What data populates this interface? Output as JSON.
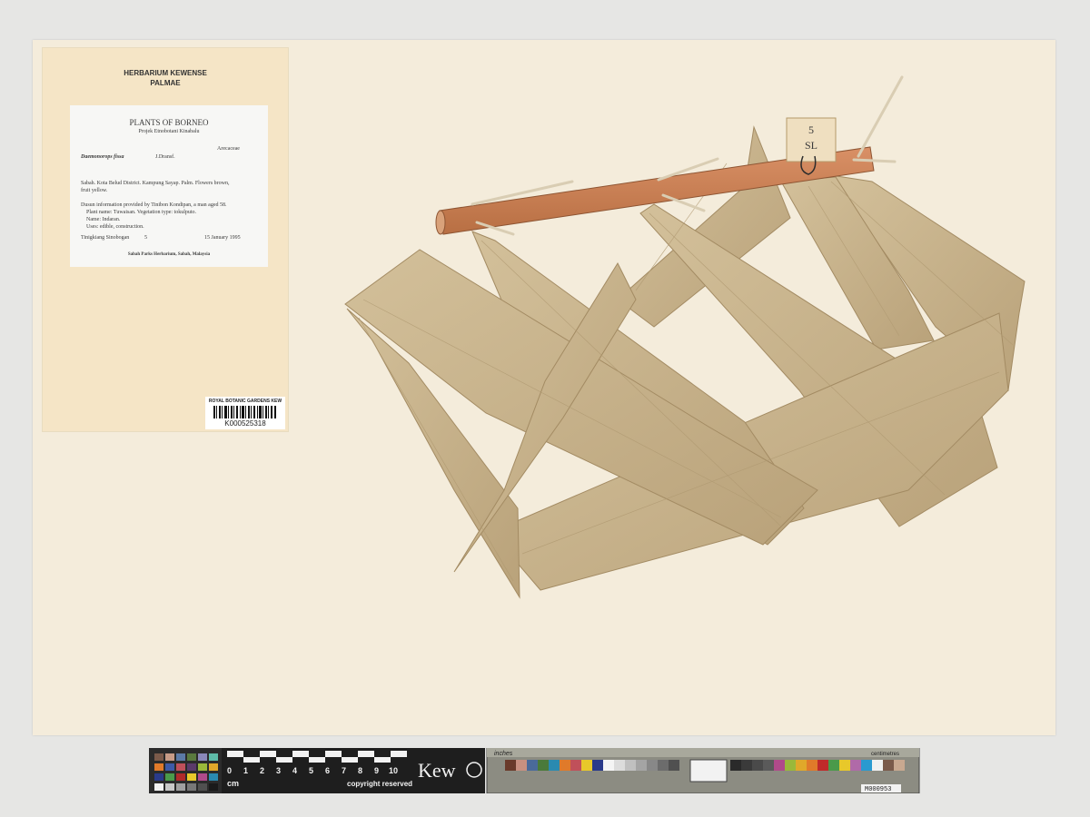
{
  "herbarium_label": {
    "line1": "HERBARIUM KEWENSE",
    "line2": "PALMAE"
  },
  "collection_label": {
    "title": "PLANTS OF BORNEO",
    "subtitle": "Projek Etnobotani Kinabalu",
    "family": "Arecaceae",
    "species": "Daemonorops fissa",
    "author": "J.Dransf.",
    "locality_1": "Sabah.  Kota Belud District.  Kampung Sayap.  Palm.  Flowers brown,",
    "locality_2": "fruit yellow.",
    "info_1": "Dusun information provided by Tinibon Kondipan, a man aged 58.",
    "info_2": "Plant name: Tuwaisan.  Vegetation type: tokulputo.",
    "info_3": "Name: Indaran.",
    "info_4": "Uses: edible, construction.",
    "collector": "Tinigkiang Sinobogan",
    "number": "5",
    "date": "15 January 1995",
    "institution": "Sabah Parks Herbarium, Sabah, Malaysia"
  },
  "barcode_label": {
    "institution": "ROYAL BOTANIC GARDENS KEW",
    "barcode": "K000525318"
  },
  "specimen_tag": {
    "line1": "5",
    "line2": "SL"
  },
  "scale_bar": {
    "unit": "cm",
    "ticks": [
      "0",
      "1",
      "2",
      "3",
      "4",
      "5",
      "6",
      "7",
      "8",
      "9",
      "10"
    ],
    "copyright": "copyright reserved",
    "brand": "Kew",
    "inches": "inches",
    "centimetres": "centimetres",
    "colorcard_id": "M000953"
  },
  "colors": {
    "sheet": "#f4ecdb",
    "background": "#e6e6e4",
    "leaf": "#c9b48c",
    "stem": "#c97d4e"
  }
}
